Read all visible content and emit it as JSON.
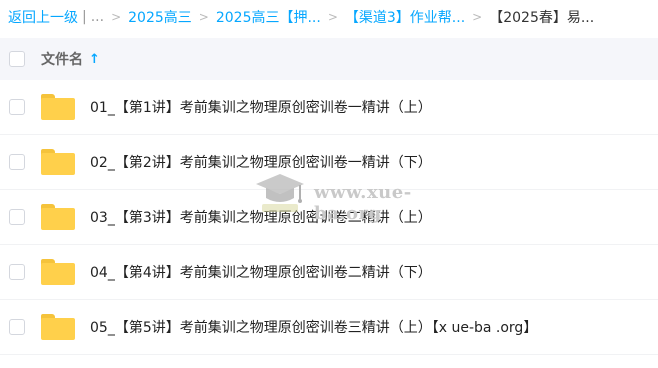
{
  "breadcrumb": {
    "back_label": "返回上一级",
    "divider": "|",
    "ellipsis": "...",
    "separator": ">",
    "crumbs": [
      "2025高三",
      "2025高三【押...",
      "【渠道3】作业帮...",
      "【2025春】易..."
    ]
  },
  "header": {
    "column_name": "文件名",
    "sort_indicator": "↑"
  },
  "files": [
    {
      "name": "01_【第1讲】考前集训之物理原创密训卷一精讲（上）",
      "icon": "folder-icon"
    },
    {
      "name": "02_【第2讲】考前集训之物理原创密训卷一精讲（下）",
      "icon": "folder-icon"
    },
    {
      "name": "03_【第3讲】考前集训之物理原创密训卷二精讲（上）",
      "icon": "folder-icon"
    },
    {
      "name": "04_【第4讲】考前集训之物理原创密训卷二精讲（下）",
      "icon": "folder-icon"
    },
    {
      "name": "05_【第5讲】考前集训之物理原创密训卷三精讲（上）【x ue-ba .org】",
      "icon": "folder-icon"
    }
  ],
  "watermark": {
    "text": "www.xue-ba.org",
    "icon": "graduation-cap-icon"
  },
  "colors": {
    "accent": "#06a7ff",
    "folder": "#ffd04b",
    "header_bg": "#f5f6fa"
  }
}
